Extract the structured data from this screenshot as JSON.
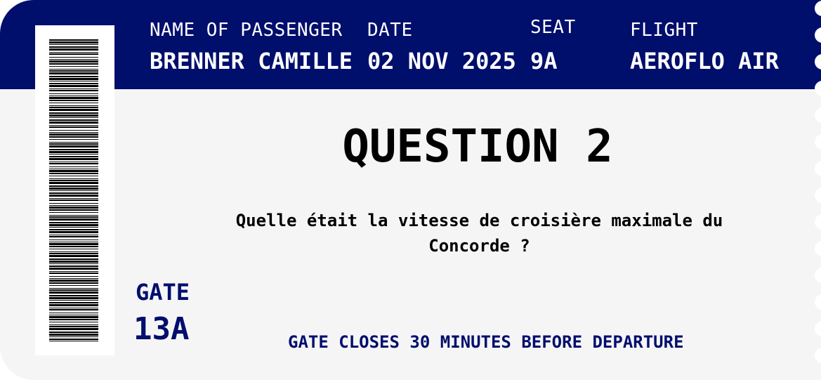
{
  "colors": {
    "header_bg": "#000e6c",
    "ticket_bg": "#f5f5f6",
    "accent_text": "#000e6c"
  },
  "header": {
    "passenger_label": "NAME OF PASSENGER",
    "passenger_value": "BRENNER CAMILLE",
    "date_label": "DATE",
    "date_value": "02 NOV 2025",
    "seat_label": "SEAT",
    "seat_value": "9A",
    "flight_label": "FLIGHT",
    "flight_value": "AEROFLO AIR"
  },
  "main": {
    "title": "QUESTION 2",
    "question": "Quelle était la vitesse de croisière maximale du Concorde ?",
    "gate_label": "GATE",
    "gate_value": "13A",
    "notice": "GATE CLOSES 30 MINUTES BEFORE DEPARTURE"
  },
  "barcode_icon": "barcode-icon"
}
